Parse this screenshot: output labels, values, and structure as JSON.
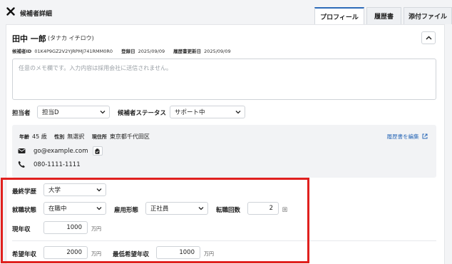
{
  "header": {
    "title": "候補者詳細",
    "tabs": [
      {
        "label": "プロフィール",
        "active": true
      },
      {
        "label": "履歴書",
        "active": false
      },
      {
        "label": "添付ファイル",
        "active": false
      }
    ]
  },
  "candidate": {
    "name": "田中 一郎",
    "kana": "(タナカ イチロウ)",
    "id_label": "候補者ID",
    "id": "01K4P9GZ2V2YJRPMJ741RMM0R0",
    "registered_label": "登録日",
    "registered": "2025/09/09",
    "updated_label": "履歴書更新日",
    "updated": "2025/09/09"
  },
  "memo": {
    "placeholder": "任意のメモ欄です。入力内容は採用会社に送信されません。"
  },
  "assignment": {
    "owner_label": "担当者",
    "owner_value": "担当D",
    "status_label": "候補者ステータス",
    "status_value": "サポート中"
  },
  "profile": {
    "age_label": "年齢",
    "age": "45 歳",
    "gender_label": "性別",
    "gender": "無選択",
    "address_label": "現住所",
    "address": "東京都千代田区",
    "edit_link": "履歴書を編集",
    "email": "go@example.com",
    "phone": "080-1111-1111"
  },
  "career": {
    "education_label": "最終学歴",
    "education_value": "大学",
    "employment_label": "就職状態",
    "employment_value": "在職中",
    "type_label": "雇用形態",
    "type_value": "正社員",
    "changes_label": "転職回数",
    "changes_value": "2",
    "changes_unit": "回",
    "income_label": "現年収",
    "income_value": "1000",
    "income_unit": "万円",
    "desired_label": "希望年収",
    "desired_value": "2000",
    "desired_unit": "万円",
    "min_label": "最低希望年収",
    "min_value": "1000",
    "min_unit": "万円"
  },
  "colors": {
    "accent": "#2e6bb8",
    "highlight": "#e0201e"
  }
}
